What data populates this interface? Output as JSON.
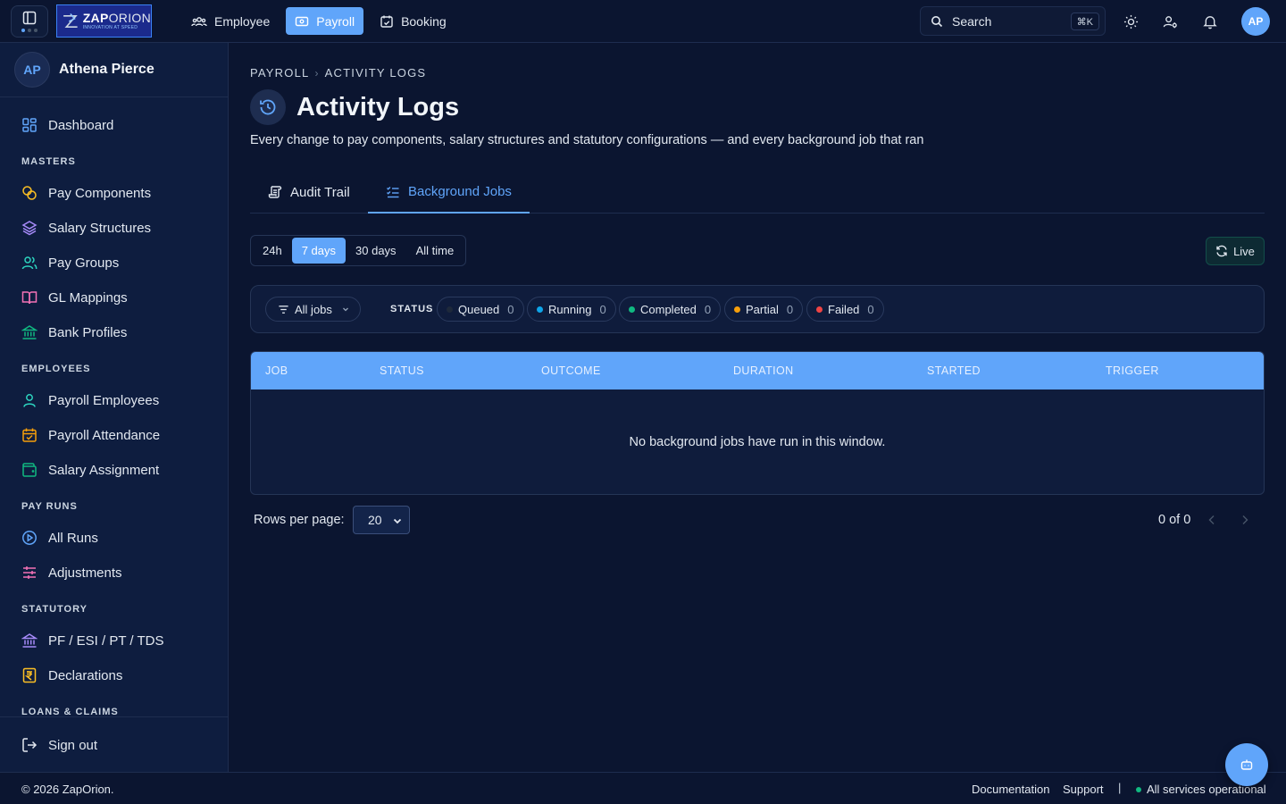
{
  "logo": {
    "name_bold": "ZAP",
    "name_rest": "ORION",
    "tagline": "INNOVATION AT SPEED"
  },
  "topnav": [
    {
      "label": "Employee",
      "icon": "users-icon"
    },
    {
      "label": "Payroll",
      "icon": "wallet-icon",
      "active": true
    },
    {
      "label": "Booking",
      "icon": "calendar-check-icon"
    }
  ],
  "search": {
    "label": "Search",
    "shortcut": "⌘K"
  },
  "user": {
    "initials": "AP",
    "name": "Athena Pierce"
  },
  "sidebar": {
    "items": [
      {
        "label": "Dashboard",
        "icon": "dashboard-icon"
      },
      {
        "label": "Pay Components",
        "icon": "coins-icon"
      },
      {
        "label": "Salary Structures",
        "icon": "layers-icon"
      },
      {
        "label": "Pay Groups",
        "icon": "users-icon"
      },
      {
        "label": "GL Mappings",
        "icon": "book-open-icon"
      },
      {
        "label": "Bank Profiles",
        "icon": "bank-icon"
      },
      {
        "label": "Payroll Employees",
        "icon": "user-icon"
      },
      {
        "label": "Payroll Attendance",
        "icon": "calendar-check-icon"
      },
      {
        "label": "Salary Assignment",
        "icon": "wallet-icon"
      },
      {
        "label": "All Runs",
        "icon": "play-circle-icon"
      },
      {
        "label": "Adjustments",
        "icon": "sliders-icon"
      },
      {
        "label": "PF / ESI / PT / TDS",
        "icon": "landmark-icon"
      },
      {
        "label": "Declarations",
        "icon": "rupee-receipt-icon"
      }
    ],
    "sections": [
      "MASTERS",
      "EMPLOYEES",
      "PAY RUNS",
      "STATUTORY",
      "LOANS & CLAIMS"
    ],
    "signout": "Sign out"
  },
  "breadcrumb": [
    "PAYROLL",
    "ACTIVITY LOGS"
  ],
  "page": {
    "title": "Activity Logs",
    "subtitle": "Every change to pay components, salary structures and statutory configurations — and every background job that ran"
  },
  "tabs": [
    {
      "label": "Audit Trail",
      "active": false
    },
    {
      "label": "Background Jobs",
      "active": true
    }
  ],
  "ranges": [
    "24h",
    "7 days",
    "30 days",
    "All time"
  ],
  "active_range": "7 days",
  "live_label": "Live",
  "filters": {
    "jobs_label": "All jobs",
    "status_label": "STATUS",
    "chips": [
      {
        "label": "Queued",
        "count": "0",
        "color": "#1e293b"
      },
      {
        "label": "Running",
        "count": "0",
        "color": "#0ea5e9"
      },
      {
        "label": "Completed",
        "count": "0",
        "color": "#10b981"
      },
      {
        "label": "Partial",
        "count": "0",
        "color": "#f59e0b"
      },
      {
        "label": "Failed",
        "count": "0",
        "color": "#ef4444"
      }
    ]
  },
  "table": {
    "columns": [
      "JOB",
      "STATUS",
      "OUTCOME",
      "DURATION",
      "STARTED",
      "TRIGGER"
    ],
    "empty_message": "No background jobs have run in this window."
  },
  "pager": {
    "rows_label": "Rows per page:",
    "rows_value": "20",
    "count": "0 of 0"
  },
  "footer": {
    "copyright": "© 2026 ZapOrion.",
    "links": [
      "Documentation",
      "Support"
    ],
    "separator": "|",
    "status": "All services operational"
  },
  "colors": {
    "accent": "#60a5fa",
    "background": "#0b1530",
    "sidebar": "#0e1d3f"
  }
}
